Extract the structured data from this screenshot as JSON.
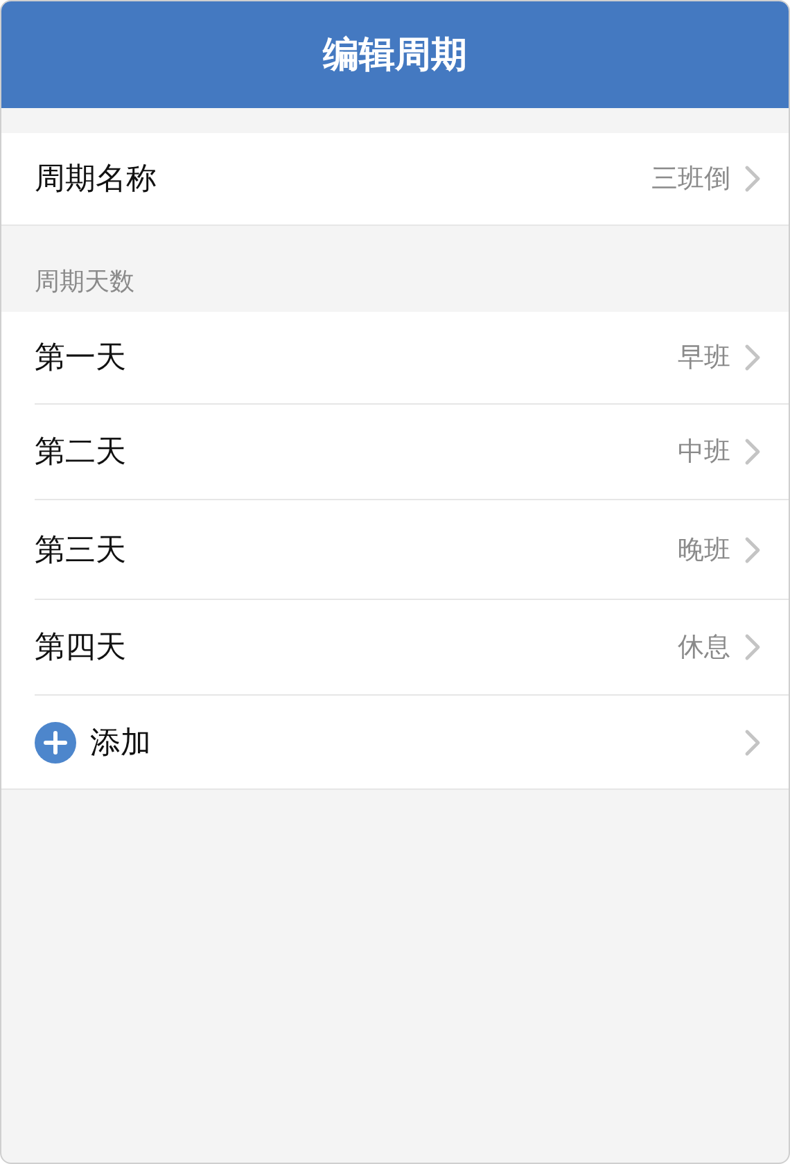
{
  "header": {
    "title": "编辑周期"
  },
  "cycle_name": {
    "label": "周期名称",
    "value": "三班倒"
  },
  "section": {
    "title": "周期天数"
  },
  "days": [
    {
      "label": "第一天",
      "value": "早班"
    },
    {
      "label": "第二天",
      "value": "中班"
    },
    {
      "label": "第三天",
      "value": "晚班"
    },
    {
      "label": "第四天",
      "value": "休息"
    }
  ],
  "add": {
    "label": "添加"
  }
}
